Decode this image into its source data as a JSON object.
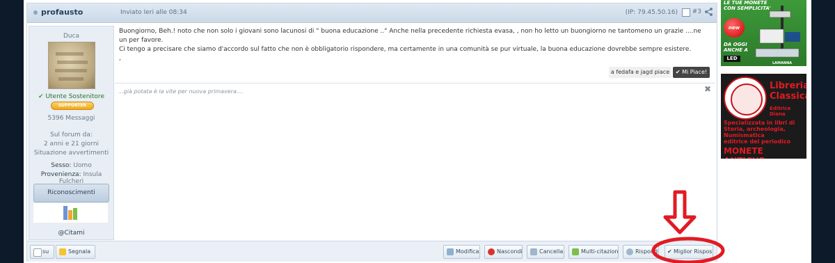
{
  "post": {
    "author": "profausto",
    "sent": "Inviato Ieri alle 08:34",
    "ip": "(IP: 79.45.50.16)",
    "number": "#3",
    "body_lines": [
      "Buongiorno, Beh.! noto che non solo i giovani sono lacunosi di \" buona educazione ..\" Anche nella precedente richiesta evasa, , non ho letto un buongiorno ne tantomeno un grazie ....ne un per favore.",
      "Ci tengo a precisare che siamo d'accordo sul fatto che non è obbligatorio rispondere, ma certamente in una comunità se pur virtuale, la buona educazione dovrebbe sempre esistere.",
      ","
    ],
    "likers": "a fedafa e jagd piace",
    "like_button": "Mi Piace!",
    "signature": "...già potata è la vite per nuova primavera....",
    "close_symbol": "✖"
  },
  "user": {
    "rank": "Duca",
    "member_type": "Utente Sostenitore",
    "badge": "SUPPORTER",
    "messages": "5396 Messaggi",
    "forum_since_label": "Sul forum da:",
    "forum_since_value": "2 anni e 21 giorni",
    "warnings": "Situazione avvertimenti",
    "sex_label": "Sesso:",
    "sex_value": "Uomo",
    "origin_label": "Provenienza:",
    "origin_value": "Insula Fulcheri",
    "recognitions_button": "Riconoscimenti",
    "mention": "@Citami"
  },
  "footer": {
    "left_buttons": [
      "su",
      "Segnala"
    ],
    "right_buttons": [
      "Modifica",
      "Nascondi",
      "Cancella",
      "Multi-citazione",
      "Rispondi",
      "Miglior Risposta"
    ]
  },
  "ads": {
    "ad1_text_lines": [
      "LE TUE MONETE",
      "CON SEMPLICITA'"
    ],
    "ad1_badge": "new",
    "ad1_bottom_lines": [
      "DA OGGI",
      "ANCHE A"
    ],
    "ad1_led": "LED",
    "ad1_brand": "LAMANNA",
    "ad2_title_lines": [
      "Libreria",
      "Classica"
    ],
    "ad2_editor": "Editrice Diana",
    "ad2_desc_lines": [
      "Specializzata in libri di",
      "Storia, archeologia, Numismatica",
      "editrice del periodico"
    ],
    "ad2_big": "MONETE ANTICHE"
  },
  "colors": {
    "background": "#0c1a29",
    "header": "#cbd9e7",
    "like_button": "#444444",
    "annotation_red": "#e11b23"
  }
}
